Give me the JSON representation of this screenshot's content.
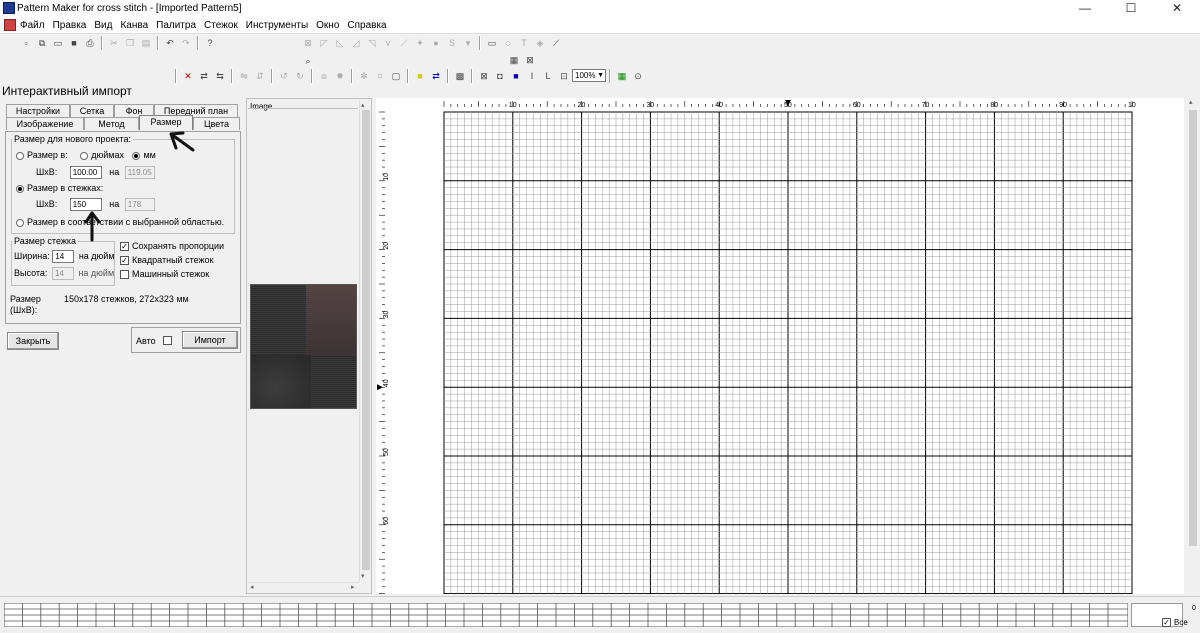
{
  "window": {
    "title": "Pattern Maker for cross stitch - [Imported Pattern5]",
    "controls": {
      "minimize": "—",
      "maximize": "☐",
      "close": "✕"
    }
  },
  "menu": [
    "Файл",
    "Правка",
    "Вид",
    "Канва",
    "Палитра",
    "Стежок",
    "Инструменты",
    "Окно",
    "Справка"
  ],
  "toolbar": {
    "zoom_value": "100%"
  },
  "import_panel": {
    "title": "Интерактивный импорт",
    "tabs_row1": [
      "Настройки",
      "Сетка",
      "Фон",
      "Передний план"
    ],
    "tabs_row2": [
      "Изображение",
      "Метод",
      "Размер",
      "Цвета"
    ],
    "active_tab": "Размер",
    "new_project_size": {
      "legend": "Размер для нового проекта:",
      "size_in_label": "Размер в:",
      "unit_inches": "дюймах",
      "unit_mm": "мм",
      "selected_unit": "мм",
      "wxh_label": "ШхВ:",
      "width_value": "100.00",
      "on_label": "на",
      "height_value": "119.05",
      "stitch_size_label": "Размер в стежках:",
      "wxh_label2": "ШхВ:",
      "stitch_width_value": "150",
      "on_label2": "на",
      "stitch_height_value": "178",
      "selection_label": "Размер в соответствии с выбранной областью."
    },
    "stitch_size": {
      "legend": "Размер стежка",
      "width_label": "Ширина:",
      "width_value": "14",
      "per_inch1": "на дюйм",
      "height_label": "Высота:",
      "height_value": "14",
      "per_inch2": "на дюйм"
    },
    "options": {
      "keep_proportions": "Сохранять пропорции",
      "keep_proportions_checked": true,
      "square_stitch": "Квадратный стежок",
      "square_stitch_checked": true,
      "machine_stitch": "Машинный стежок",
      "machine_stitch_checked": false
    },
    "size_info_label": "Размер (ШхВ):",
    "size_info_value": "150x178 стежков, 272x323 мм",
    "close_button": "Закрыть",
    "auto_label": "Авто",
    "import_button": "Импорт"
  },
  "image_pane": {
    "label": "Image"
  },
  "ruler": {
    "top_labels": [
      "10",
      "20",
      "30",
      "40",
      "50",
      "60",
      "70",
      "80",
      "90",
      "10"
    ],
    "left_labels": [
      "10",
      "20",
      "30",
      "40",
      "50",
      "60"
    ]
  },
  "statusbar": {
    "all_label": "Все",
    "corner_value": "0"
  }
}
